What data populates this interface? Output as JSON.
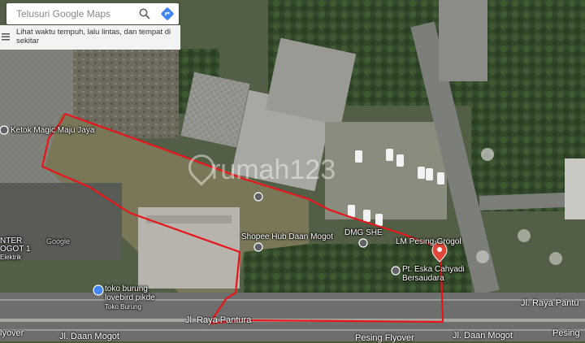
{
  "search": {
    "placeholder": "Telusuri Google Maps",
    "hint": "Lihat waktu tempuh, lalu lintas, dan tempat di sekitar"
  },
  "places": {
    "ketok_magic": "Ketok Magic Maju Jaya",
    "shopee_hub": "Shopee Hub Daan Mogot",
    "dmg": "DMG SHE",
    "lm_pesing": "LM Pesing-Grogol",
    "pt_eska_line1": "Pt. Eska Cahyadi",
    "pt_eska_line2": "Bersaudara",
    "toko_burung_line1": "toko burung",
    "toko_burung_line2": "lovebird pikde",
    "toko_burung_category": "Toko Burung",
    "center_partial_line1": "NTER",
    "center_partial_line2": "OGOT 1",
    "center_partial_category": "Elektrik",
    "google_watermark": "Google"
  },
  "roads": {
    "raya_pantura_left": "Jl. Raya Pantura",
    "raya_pantura_right": "Jl. Raya Pantu",
    "daan_mogot_left": "Jl. Daan Mogot",
    "daan_mogot_right": "Jl. Daan Mogot",
    "pesing_flyover": "Pesing Flyover",
    "flyover_left": "lyover",
    "pesing_right": "Pesing"
  },
  "watermark": "rumah123",
  "colors": {
    "outline": "#e8151b",
    "accent_blue": "#4285f4",
    "pin_red": "#e0463a"
  }
}
